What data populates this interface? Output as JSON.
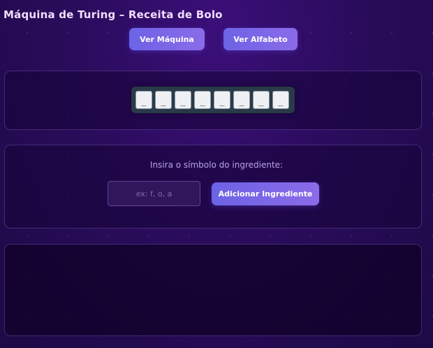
{
  "header": {
    "title": "Máquina de Turing – Receita de Bolo",
    "view_machine_label": "Ver Máquina",
    "view_alphabet_label": "Ver Alfabeto"
  },
  "tape": {
    "cells": [
      "_",
      "_",
      "_",
      "_",
      "_",
      "_",
      "_",
      "_"
    ]
  },
  "ingredient_form": {
    "prompt": "Insira o símbolo do ingrediente:",
    "placeholder": "ex: f, o, a",
    "value": "",
    "add_label": "Adicionar Ingrediente"
  },
  "theme": {
    "background": "#2a0c5c",
    "button_gradient_start": "#6c63e6",
    "button_gradient_end": "#8b6be8",
    "tape_background": "#2a3a48",
    "cell_background": "#eef0f4"
  }
}
